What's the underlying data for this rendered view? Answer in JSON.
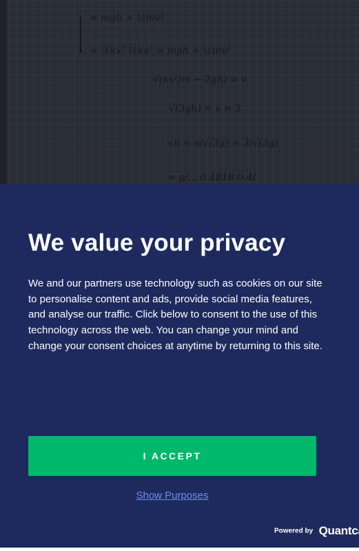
{
  "consent": {
    "title": "We value your privacy",
    "body": "We and our partners use technology such as cookies on our site to personalise content and ads, provide social media features, and analyse our traffic. Click below to consent to the use of this technology across the web. You can change your mind and change your consent choices at anytime by returning to this site.",
    "accept_label": "I ACCEPT",
    "purposes_label": "Show Purposes",
    "powered_by_label": "Powered by",
    "powered_by_brand": "Quantcast"
  },
  "background_note": {
    "line1": "= mgh + ½mv²",
    "line2": "= ½kx²    ½kx² = mgh + ½mv²",
    "line3": "√(kx²/m − 2gh) = v",
    "line4": "√(3gh) = v = 3",
    "line5": "√h = v/√(3g) = 3/√(3g)",
    "line6": "= g/... 0.1818  0.4("
  },
  "colors": {
    "banner_bg": "#1e2a5e",
    "accept_bg": "#00b86b",
    "link": "#6f8ee8",
    "text": "#ffffff"
  }
}
